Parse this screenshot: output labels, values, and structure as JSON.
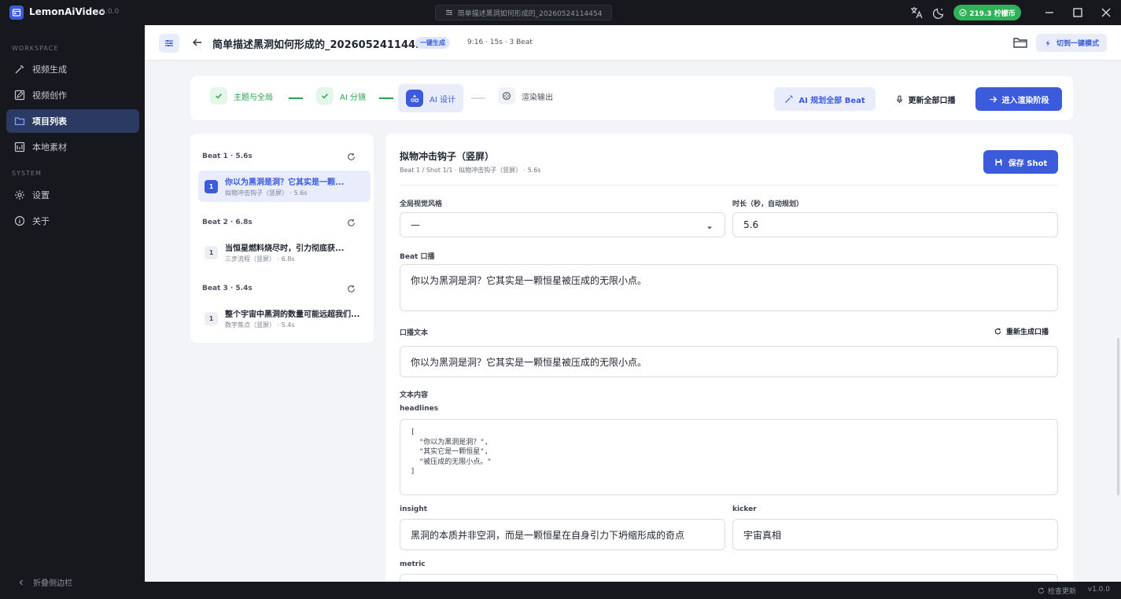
{
  "app": {
    "name": "LemonAiVideo",
    "version": "v1.0.0"
  },
  "titlebar": {
    "doc_title": "简单描述黑洞如何形成的_20260524114454",
    "credits": "219.3 柠檬币"
  },
  "sidebar": {
    "section_workspace": "WORKSPACE",
    "section_system": "SYSTEM",
    "items": [
      {
        "label": "视频生成",
        "icon": "magic-wand-icon"
      },
      {
        "label": "视频创作",
        "icon": "edit-icon"
      },
      {
        "label": "项目列表",
        "icon": "folder-icon",
        "active": true
      },
      {
        "label": "本地素材",
        "icon": "image-library-icon"
      },
      {
        "label": "设置",
        "icon": "gear-icon"
      },
      {
        "label": "关于",
        "icon": "info-icon"
      }
    ],
    "collapse_label": "折叠侧边栏"
  },
  "statusbar": {
    "check_update": "检查更新",
    "version": "v1.0.0"
  },
  "header": {
    "title": "简单描述黑洞如何形成的_20260524114454",
    "badge": "一键生成",
    "meta": "9:16 · 15s · 3 Beat",
    "switch_label": "切到一键模式"
  },
  "stepper": {
    "steps": [
      {
        "label": "主题与全局",
        "state": "done"
      },
      {
        "label": "AI 分镜",
        "state": "done"
      },
      {
        "label": "AI 设计",
        "state": "current"
      },
      {
        "label": "渲染输出",
        "state": "todo"
      }
    ],
    "plan_all": "AI 规划全部 Beat",
    "update_voice": "更新全部口播",
    "enter_render": "进入渲染阶段"
  },
  "beats": [
    {
      "header": "Beat 1 · 5.6s",
      "shots": [
        {
          "num": "1",
          "title": "你以为黑洞是洞？它其实是一颗...",
          "sub": "拟物冲击钩子（竖屏） · 5.6s",
          "active": true
        }
      ]
    },
    {
      "header": "Beat 2 · 6.8s",
      "shots": [
        {
          "num": "1",
          "title": "当恒星燃料烧尽时，引力彻底获...",
          "sub": "三步流程（竖屏） · 6.8s"
        }
      ]
    },
    {
      "header": "Beat 3 · 5.4s",
      "shots": [
        {
          "num": "1",
          "title": "整个宇宙中黑洞的数量可能远超我们...",
          "sub": "数字焦点（竖屏） · 5.4s"
        }
      ]
    }
  ],
  "editor": {
    "title": "拟物冲击钩子（竖屏）",
    "subtitle": "Beat 1 / Shot 1/1 · 拟物冲击钩子（竖屏） · 5.6s",
    "save_label": "保存 Shot",
    "style_label": "全局视觉风格",
    "style_value": "—",
    "duration_label": "时长（秒，自动规划）",
    "duration_value": "5.6",
    "beat_voice_label": "Beat 口播",
    "beat_voice_value": "你以为黑洞是洞？它其实是一颗恒星被压成的无限小点。",
    "voice_text_label": "口播文本",
    "regen_label": "重新生成口播",
    "voice_text_value": "你以为黑洞是洞？它其实是一颗恒星被压成的无限小点。",
    "text_content_label": "文本内容",
    "headlines_label": "headlines",
    "headlines_value": "[\n  \"你以为黑洞是洞？\",\n  \"其实它是一颗恒星\",\n  \"被压成的无限小点。\"\n]",
    "insight_label": "insight",
    "insight_value": "黑洞的本质并非空洞，而是一颗恒星在自身引力下坍缩形成的奇点",
    "kicker_label": "kicker",
    "kicker_value": "宇宙真相",
    "metric_label": "metric"
  },
  "colors": {
    "accent": "#3b5bdb",
    "success": "#27a34b",
    "sidebar_bg": "#17181d",
    "active_item": "#2b3a63"
  }
}
